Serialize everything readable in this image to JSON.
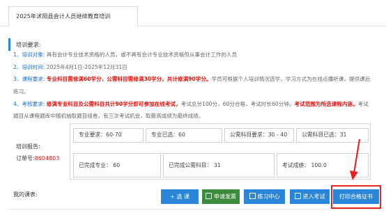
{
  "tab": {
    "title": "2025年沭阳县会计人员继续教育培训"
  },
  "requirements": {
    "heading": "培训要求:",
    "item1": {
      "num": "1、",
      "label": "培训对象:",
      "text": "具有会计专业技术资格的人员，或不具有会计专业技术资格但从事会计工作的人员"
    },
    "item2": {
      "num": "2、",
      "label": "培训时间:",
      "text": "2025年4月1日-2025年12月31日"
    },
    "item3": {
      "num": "3、",
      "label": "课程要求:",
      "red": "专业科目需修满60学分，公需科目需修满30学分，共计修满90学分。",
      "text_a": "学员可根据个人培训情况选学，学习方式为在线点播听课，提供课后",
      "text_b": "练习。"
    },
    "item4": {
      "num": "4、",
      "label": "考核要求:",
      "red_a": "修满专业科目及公需科目共计90学分即可参加在线考试，",
      "text_a": "考试总分100分，60分合格，考试时长60分钟。",
      "red_b": "考试范围为所选课程内容。",
      "text_b": "考试",
      "text_c": "题目从课程题库中随机抽取题目组卷，有三次考试机会，取最高成绩为最终成绩。"
    }
  },
  "report": {
    "label": "培训报告:",
    "order_label": "订单号:",
    "order_no": "8604803",
    "cells": {
      "prof_required": "专业要求：60-70",
      "prof_selected": "专业已选：60",
      "public_required": "公需科目要求：30 - 40",
      "public_selected": "公需科目已选：31",
      "prof_done": "已完成专业：  60",
      "public_done": "已完成公需科目：  31",
      "exam_score": "考试成绩：  100.0"
    }
  },
  "lessons": {
    "label": "我的课表:",
    "buttons": {
      "select": "+ 选  课",
      "invoice": "申请发票",
      "practice": "练习中心",
      "exam": "进入考试",
      "certificate": "打印合格证书"
    }
  },
  "colors": {
    "accent": "#2a86d9",
    "green": "#3d8b3d",
    "red": "#e8110c",
    "highlight": "#e8231c"
  }
}
